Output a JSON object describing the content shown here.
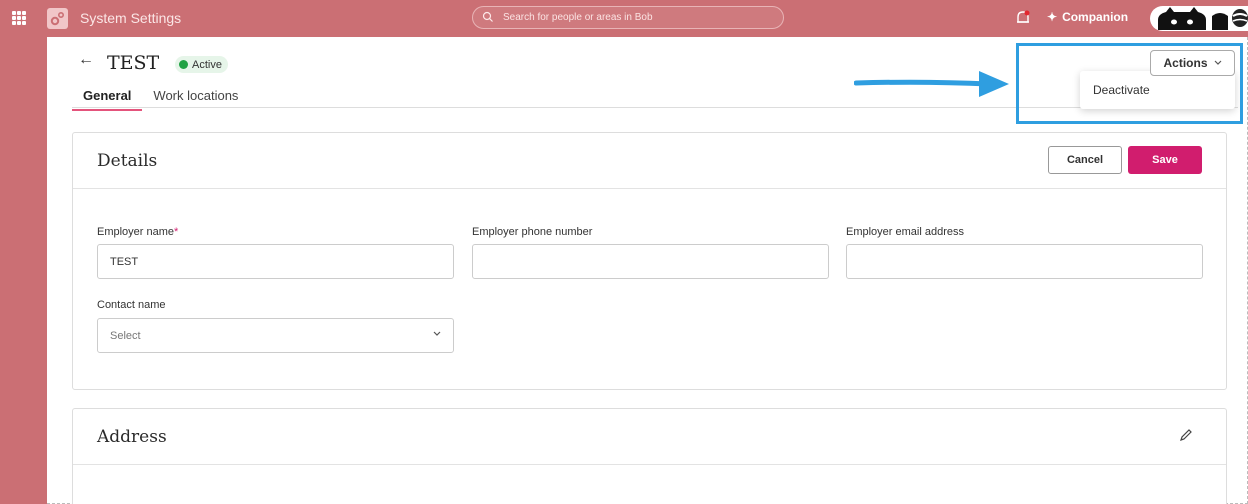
{
  "topbar": {
    "app_title": "System Settings",
    "search_placeholder": "Search for people or areas in Bob",
    "companion_label": "Companion",
    "icons": [
      "apps-grid-icon",
      "settings-gear-icon",
      "search-icon",
      "bell-icon",
      "sparkle-icon"
    ]
  },
  "page": {
    "title": "TEST",
    "status": "Active",
    "tabs": [
      {
        "label": "General",
        "active": true
      },
      {
        "label": "Work locations",
        "active": false
      }
    ],
    "actions_label": "Actions",
    "dropdown_items": [
      "Deactivate"
    ]
  },
  "details": {
    "title": "Details",
    "cancel_label": "Cancel",
    "save_label": "Save",
    "fields": {
      "employer_name": {
        "label": "Employer name",
        "required_mark": "*",
        "value": "TEST"
      },
      "employer_phone": {
        "label": "Employer phone number",
        "value": ""
      },
      "employer_email": {
        "label": "Employer email address",
        "value": ""
      },
      "contact_name": {
        "label": "Contact name",
        "placeholder": "Select"
      }
    }
  },
  "address": {
    "title": "Address"
  },
  "colors": {
    "topbar": "#cb6f74",
    "save_button": "#d11d6e",
    "active_tab_underline": "#e4547c",
    "status_dot": "#21a244",
    "annotation": "#2f9ee0"
  }
}
